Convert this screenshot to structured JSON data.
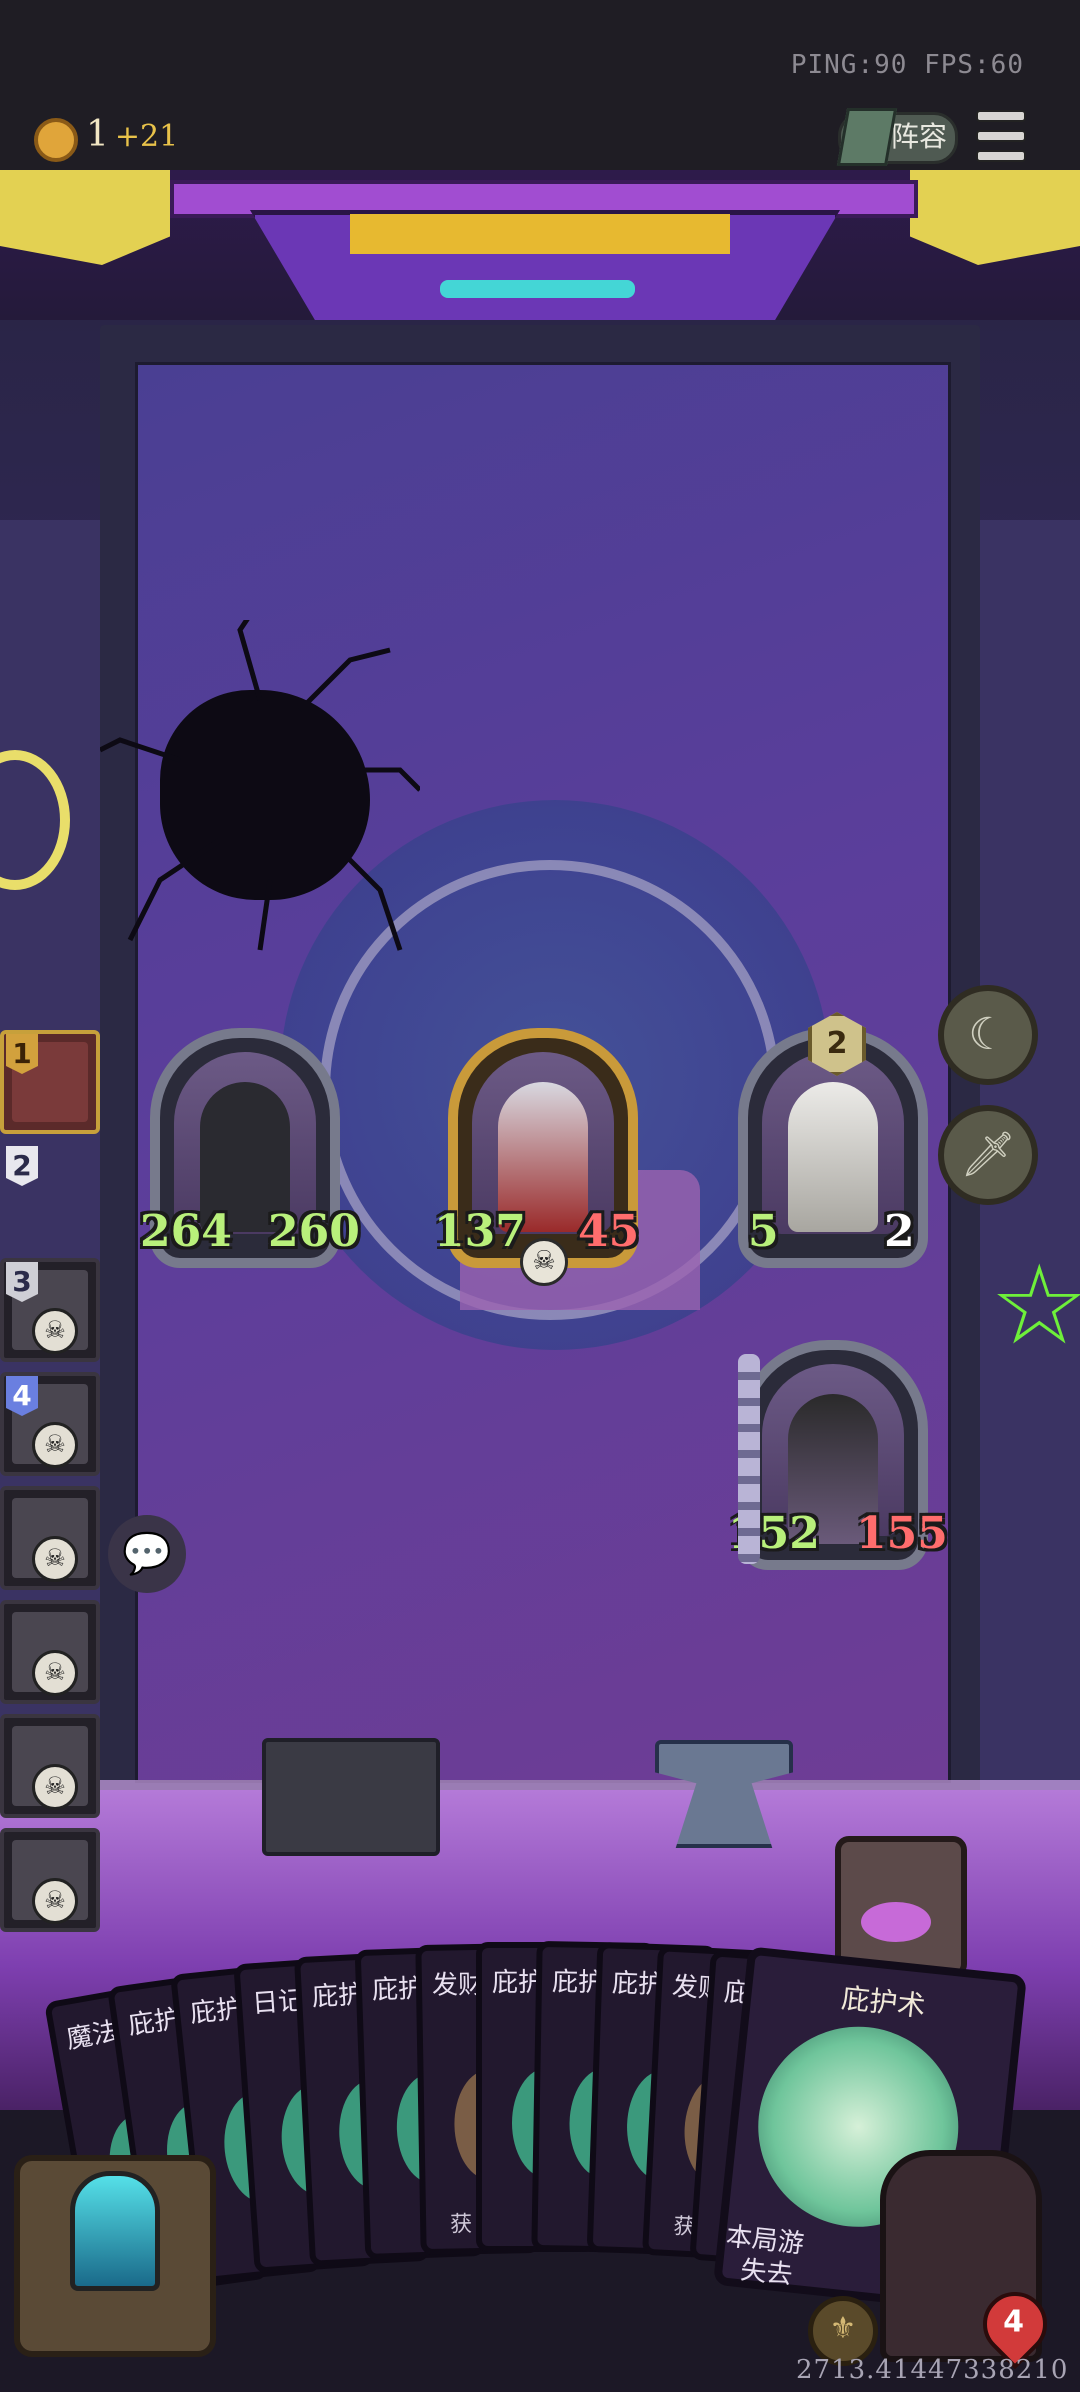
{
  "hud": {
    "ping_fps": "PING:90   FPS:60",
    "gold_value": "1",
    "gold_income": "+21",
    "lineup_label": "阵容",
    "menu_icon": "hamburger-menu-icon"
  },
  "board": {
    "units": [
      {
        "id": "dark-knight",
        "attack": "264",
        "health": "260",
        "health_color": "#b9f07b"
      },
      {
        "id": "red-cloak-knight",
        "attack": "137",
        "health": "45",
        "health_color": "#ff6d6d"
      },
      {
        "id": "white-sage",
        "attack": "5",
        "health": "2",
        "health_color": "#ffffff",
        "badge": "2"
      },
      {
        "id": "pirate-beast",
        "attack": "152",
        "health": "155",
        "health_color": "#ff6d6d"
      }
    ],
    "items": [
      "moon-icon",
      "dagger-icon"
    ]
  },
  "sidebar": {
    "ranks": [
      "1",
      "2",
      "3",
      "4",
      "",
      "",
      "",
      ""
    ]
  },
  "hand": {
    "cards": [
      "魔法",
      "庇护",
      "庇护",
      "日记",
      "庇护",
      "庇护",
      "发财",
      "庇护",
      "庇护",
      "庇护",
      "发财",
      "庇护"
    ],
    "card_body_text": [
      "获",
      "获"
    ],
    "featured_card": {
      "title": "庇护术",
      "desc_line1": "本局游",
      "desc_line2": "失去"
    }
  },
  "player": {
    "hero_hp": "4"
  },
  "footer": {
    "number": "2713.41447338210"
  }
}
